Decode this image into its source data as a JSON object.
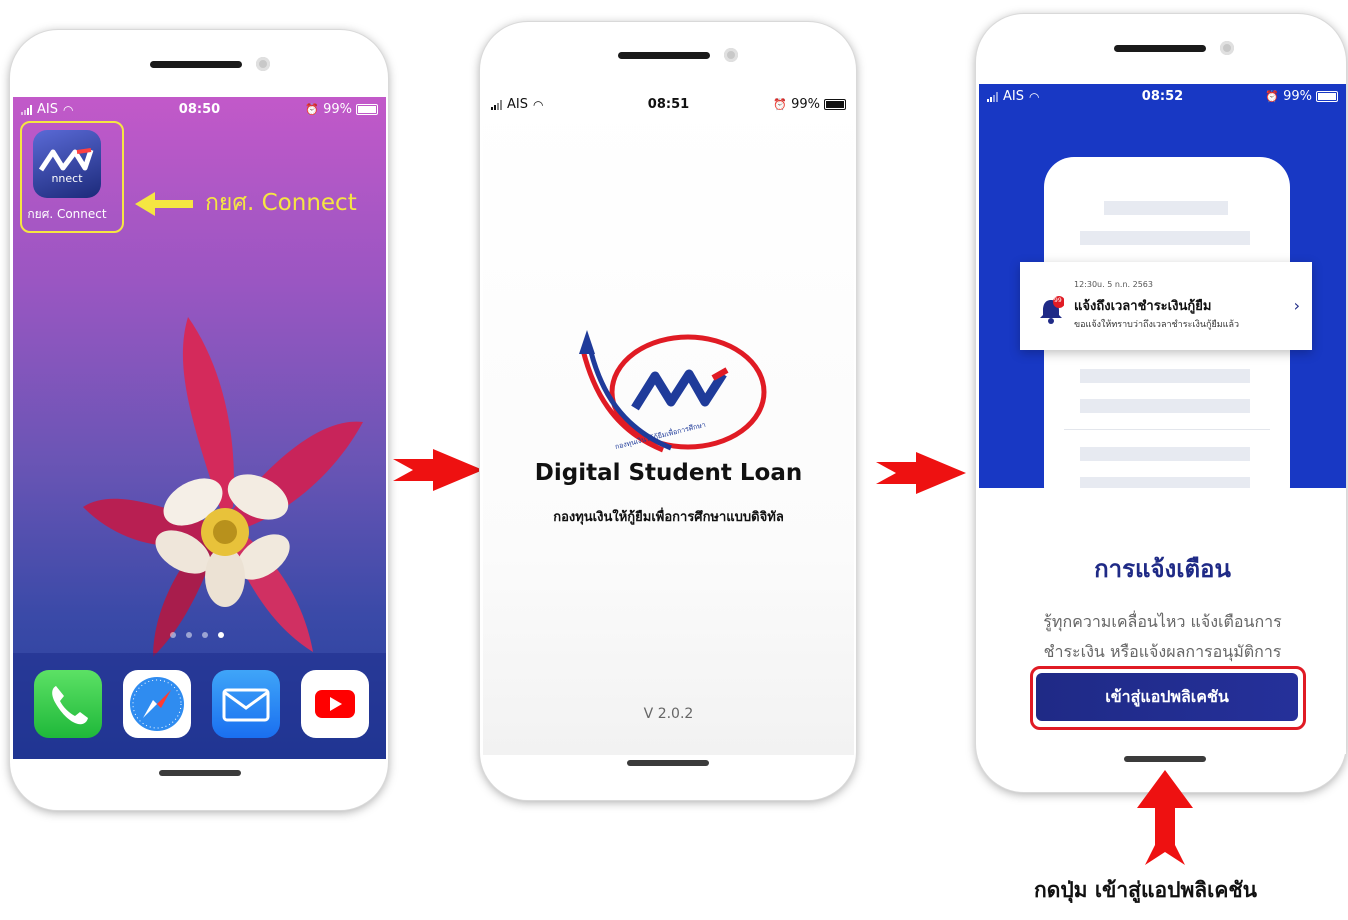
{
  "phone1": {
    "status": {
      "carrier": "AIS",
      "time": "08:50",
      "battery": "99%"
    },
    "app_label": "กยศ. Connect",
    "app_icon_text": "nnect",
    "callout": "กยศ. Connect",
    "page_dots": 4,
    "dock_icons": [
      "phone-icon",
      "safari-icon",
      "mail-icon",
      "youtube-icon"
    ]
  },
  "phone2": {
    "status": {
      "carrier": "AIS",
      "time": "08:51",
      "battery": "99%"
    },
    "logo_ring_text": "กองทุนเงินให้กู้ยืมเพื่อการศึกษา",
    "title": "Digital Student Loan",
    "subtitle": "กองทุนเงินให้กู้ยืมเพื่อการศึกษาแบบดิจิทัล",
    "version": "V 2.0.2"
  },
  "phone3": {
    "status": {
      "carrier": "AIS",
      "time": "08:52",
      "battery": "99%"
    },
    "notification": {
      "time": "12:30u. 5 n.n. 2563",
      "title": "แจ้งถึงเวลาชำระเงินกู้ยืม",
      "body": "ขอแจ้งให้ทราบว่าถึงเวลาชำระเงินกู้ยืมแล้ว",
      "badge": "99"
    },
    "heading": "การแจ้งเตือน",
    "desc_line1": "รู้ทุกความเคลื่อนไหว แจ้งเตือนการ",
    "desc_line2": "ชำระเงิน หรือแจ้งผลการอนุมัติการ",
    "button": "เข้าสู่แอปพลิเคชัน"
  },
  "instruction": "กดปุ่ม เข้าสู่แอปพลิเคชัน",
  "colors": {
    "callout_yellow": "#f5e642",
    "arrow_red": "#ee1111",
    "button_navy": "#1f2a86",
    "screen3_blue": "#1838c4"
  }
}
